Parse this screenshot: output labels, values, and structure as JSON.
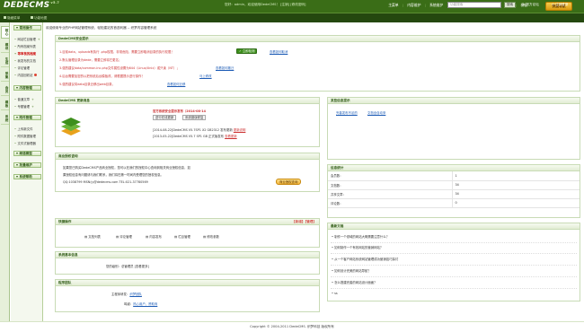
{
  "app": {
    "logo": "DEDECMS",
    "version": "v5.7",
    "top_links": "您好：admin，欢迎使用DedeCMS！ [注销] [修改密码]",
    "top_nav": [
      "主菜单",
      "内容维护",
      "系统维护",
      "用户中心",
      "生成",
      "采集",
      "会员",
      "模板",
      "系统"
    ],
    "tasks_button": "快捷导航"
  },
  "bar2": {
    "link1": "隐藏菜单",
    "link2": "功能地图",
    "search_placeholder": "功能搜索",
    "search_button": "搜索",
    "site_home": "官方论坛",
    "logout": "注销登录"
  },
  "tabs": [
    "核心",
    "模块",
    "生成",
    "采集",
    "会员",
    "模板",
    "系统"
  ],
  "menu": {
    "sections": [
      {
        "title": "常用操作",
        "items": [
          "网站栏目管理",
          "所有档案列表",
          "等审核的档案",
          "我发布的文档",
          "评论管理",
          "内容回收站"
        ]
      },
      {
        "title": "内容管理",
        "items": [
          "普通文章",
          "专题管理"
        ]
      },
      {
        "title": "附件管理",
        "items": [
          "上传新文件",
          "附件数据管理",
          "文件式管理器"
        ]
      },
      {
        "title": "频道模型",
        "items": []
      },
      {
        "title": "批量维护",
        "items": []
      },
      {
        "title": "系统帮助",
        "items": []
      }
    ]
  },
  "crumb": "欢迎使用专业的PHP网站管理系统，轻松建站的首选利器 -- 织梦内容管理系统",
  "security": {
    "title": "DedeCMS安全提示",
    "button": "立即检测",
    "lines": [
      "1.目前data、uploads有执行 .php权限，非常危险，需要立即取消目录的执行权限！",
      "2.默认管理目录为dede，需要立即将它更名；",
      "3.强烈建议data/common.inc.php文件属性设置为644（Linux/Unix）或只读（NT）；",
      "4.后台需要加密的以把系统后台模板改，请根据提示进行操作！",
      "5.强烈建议将data目录迁移出web目录。"
    ],
    "link1": "查看如何取消",
    "link2": "查看如何搬迁",
    "link3": "马上修改",
    "link4": "查看如何迁移"
  },
  "update": {
    "title": "DedeCMS 更新消息",
    "news_title": "官方系统安全提示发布（2014-08-14",
    "btn1": "进行在线更新",
    "btn2": "系统错误修复",
    "line1": "[2014-08-22]DedeCMS V5.7SP1 X2 GB2312 发布更新",
    "line1_link": "更新说明",
    "line2": "[2013-05-22]DedeCMS V5.7 SP1 GB 正式版发布",
    "line2_link": "查看更新"
  },
  "commercial": {
    "title": "商业授权咨询",
    "text1": "如果您已购买DedeCMS产品商业授权，您可以在我们的授权中心查询到相关商业授权信息，如",
    "text2": "果授权信息有问题请与我们联系，我们将在第一时间内受理您的授权信息。",
    "text3": "QQ:1038799 MSN:jy@dedecms.com TEL:021-37780569",
    "button": "商业授权查询"
  },
  "shortcuts": {
    "title": "快捷操作",
    "right": "【新增】【管理】",
    "items": [
      "文档列表",
      "评论管理",
      "内容发布",
      "栏目管理",
      "修改参数"
    ]
  },
  "sysinfo": {
    "title": "系统基本信息",
    "label": "您的级别：",
    "value": "总管理员 [查看更多]"
  },
  "team": {
    "title": "程序团队",
    "label1": "主程序研发：",
    "value1": "织梦团队",
    "label2": "鸣谢：",
    "value2": "热心用户、赞助商"
  },
  "mybooks": {
    "title": "某些信息提示",
    "links": [
      "完善发布不足的",
      "文档全自动采"
    ]
  },
  "stats": {
    "title": "信息统计",
    "rows": [
      {
        "label": "会员数：",
        "value": "1"
      },
      {
        "label": "文档数：",
        "value": "34"
      },
      {
        "label": "共享文章：",
        "value": "34"
      },
      {
        "label": "评论数：",
        "value": "0"
      }
    ]
  },
  "newest": {
    "title": "最新文档",
    "items": [
      "制作一个领域的网站大概需要注意什么？",
      "如何制作一个有效网站的营销网站？",
      "从一个客户网站系统网站管理成功营销技巧探讨",
      "如何设计完美的网站导航？",
      "怎么搭建完善的网站设计面面？",
      "ss"
    ]
  },
  "footer": {
    "text": "Copyright © 2004-2011 DedeCMS. 织梦科技 版权所有"
  }
}
